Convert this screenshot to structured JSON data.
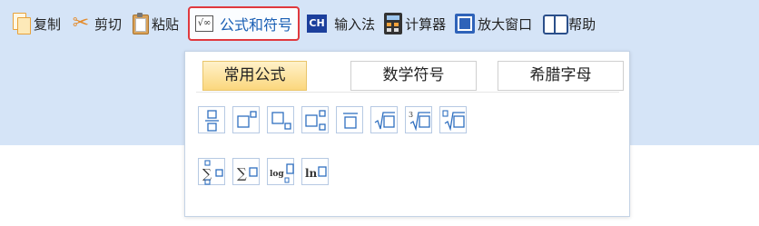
{
  "toolbar": {
    "copy": "复制",
    "cut": "剪切",
    "paste": "粘贴",
    "formula": "公式和符号",
    "formula_icon_text": "√∞",
    "ime_icon_text": "CH",
    "ime": "输入法",
    "calculator": "计算器",
    "maximize": "放大窗口",
    "help": "帮助"
  },
  "popup": {
    "tabs": [
      "常用公式",
      "数学符号",
      "希腊字母"
    ],
    "active_tab": "常用公式",
    "symbols": {
      "cube_root_index": "3",
      "sum": "∑",
      "log": "log",
      "ln": "ln"
    }
  },
  "colors": {
    "toolbar_bg": "#d5e4f7",
    "active_outline": "#e0393e",
    "active_text": "#1a5fb4",
    "tab_active_bg": "#fbd77d",
    "symbol_stroke": "#2f6fc0"
  },
  "icons": [
    "copy-icon",
    "scissors-icon",
    "clipboard-icon",
    "formula-icon",
    "ch-icon",
    "calculator-icon",
    "maximize-icon",
    "help-book-icon"
  ]
}
